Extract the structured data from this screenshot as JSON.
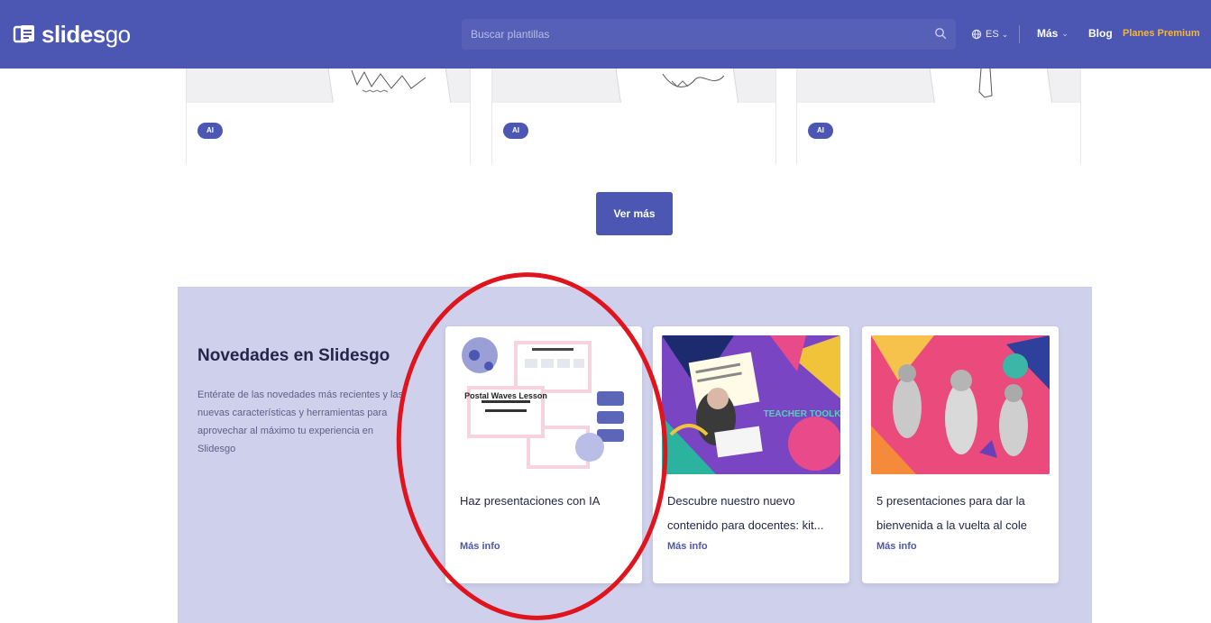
{
  "header": {
    "brand_bold": "slides",
    "brand_light": "go",
    "search_placeholder": "Buscar plantillas",
    "lang": "ES",
    "nav_more": "Más",
    "nav_blog": "Blog",
    "nav_premium": "Planes Premium"
  },
  "templates": {
    "badges": [
      "AI",
      "AI",
      "AI"
    ],
    "see_more": "Ver más"
  },
  "news": {
    "title": "Novedades en Slidesgo",
    "description": "Entérate de las novedades más recientes y las nuevas características y herramientas para aprovechar al máximo tu experiencia en Slidesgo",
    "cards": [
      {
        "title": "Haz presentaciones con IA",
        "link": "Más info",
        "image_text": "Postal Waves Lesson"
      },
      {
        "title": "Descubre nuestro nuevo contenido para docentes: kit...",
        "link": "Más info",
        "image_text": "TEACHER TOOLKIT"
      },
      {
        "title": "5 presentaciones para dar la bienvenida a la vuelta al cole",
        "link": "Más info"
      }
    ]
  },
  "colors": {
    "brand": "#4b57b2",
    "premium": "#f3b63b",
    "section_bg": "#cfd1ec",
    "annotation": "#e0141c"
  }
}
